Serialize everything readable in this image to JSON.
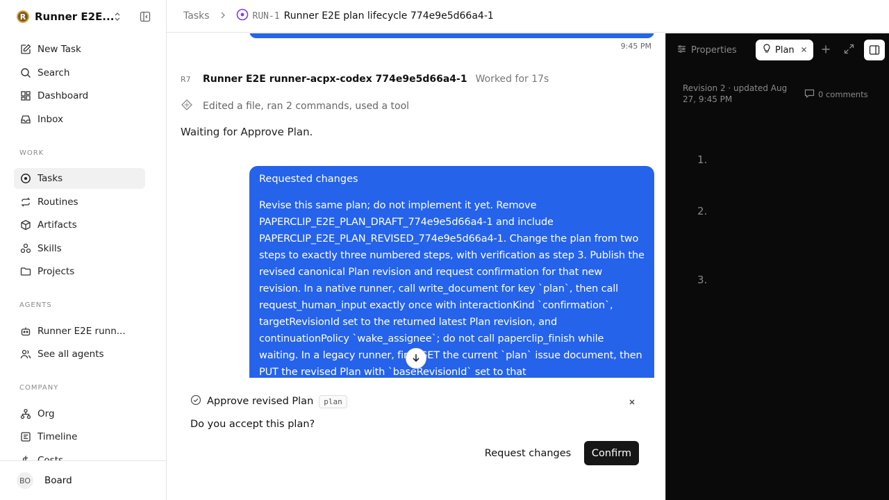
{
  "workspace": {
    "logo_letter": "R",
    "name": "Runner E2E..."
  },
  "sidebar": {
    "top_items": [
      {
        "label": "New Task",
        "icon": "pencil-square-icon"
      },
      {
        "label": "Search",
        "icon": "search-icon"
      },
      {
        "label": "Dashboard",
        "icon": "dashboard-icon"
      },
      {
        "label": "Inbox",
        "icon": "inbox-icon"
      }
    ],
    "work_label": "WORK",
    "work_items": [
      {
        "label": "Tasks",
        "icon": "circle-dot-icon",
        "active": true
      },
      {
        "label": "Routines",
        "icon": "repeat-icon"
      },
      {
        "label": "Artifacts",
        "icon": "box-icon"
      },
      {
        "label": "Skills",
        "icon": "skills-icon"
      },
      {
        "label": "Projects",
        "icon": "folder-icon"
      }
    ],
    "agents_label": "AGENTS",
    "agent_items": [
      {
        "label": "Runner E2E runn...",
        "icon": "bot-icon"
      },
      {
        "label": "See all agents",
        "icon": "users-icon"
      }
    ],
    "company_label": "COMPANY",
    "company_items": [
      {
        "label": "Org",
        "icon": "org-chart-icon"
      },
      {
        "label": "Timeline",
        "icon": "timeline-icon"
      },
      {
        "label": "Costs",
        "icon": "dollar-icon"
      }
    ],
    "footer": {
      "avatar_initials": "BO",
      "name": "Board"
    }
  },
  "header": {
    "root": "Tasks",
    "task_id": "RUN-1",
    "task_title": "Runner E2E plan lifecycle 774e9e5d66a4-1"
  },
  "thread": {
    "prev_message_time": "9:45 PM",
    "agent": {
      "badge": "R7",
      "name": "Runner E2E runner-acpx-codex 774e9e5d66a4-1",
      "worked": "Worked for 17s"
    },
    "activity_summary": "Edited a file, ran 2 commands, used a tool",
    "agent_message": "Waiting for Approve Plan.",
    "request": {
      "title": "Requested changes",
      "body": "Revise this same plan; do not implement it yet. Remove PAPERCLIP_E2E_PLAN_DRAFT_774e9e5d66a4-1 and include PAPERCLIP_E2E_PLAN_REVISED_774e9e5d66a4-1. Change the plan from two steps to exactly three numbered steps, with verification as step 3. Publish the revised canonical Plan revision and request confirmation for that new revision. In a native runner, call write_document for key `plan`, then call request_human_input exactly once with interactionKind `confirmation`, targetRevisionId set to the returned latest Plan revision, and continuationPolicy `wake_assignee`; do not call paperclip_finish while waiting. In a legacy runner, first GET the current `plan` issue document, then PUT the revised Plan with `baseRevisionId` set to that"
    }
  },
  "interaction": {
    "title": "Approve revised Plan",
    "kind_badge": "plan",
    "question": "Do you accept this plan?",
    "request_changes_label": "Request changes",
    "confirm_label": "Confirm"
  },
  "panel": {
    "properties_tab": "Properties",
    "plan_tab": "Plan",
    "revision_meta": "Revision 2 · updated Aug 27, 9:45 PM",
    "comments": "0 comments",
    "steps": [
      "1.",
      "2.",
      "3."
    ]
  },
  "colors": {
    "accent_blue": "#2563eb",
    "panel_bg": "#0a0a0a",
    "primary_button": "#161616",
    "task_status_purple": "#7c3aed"
  }
}
